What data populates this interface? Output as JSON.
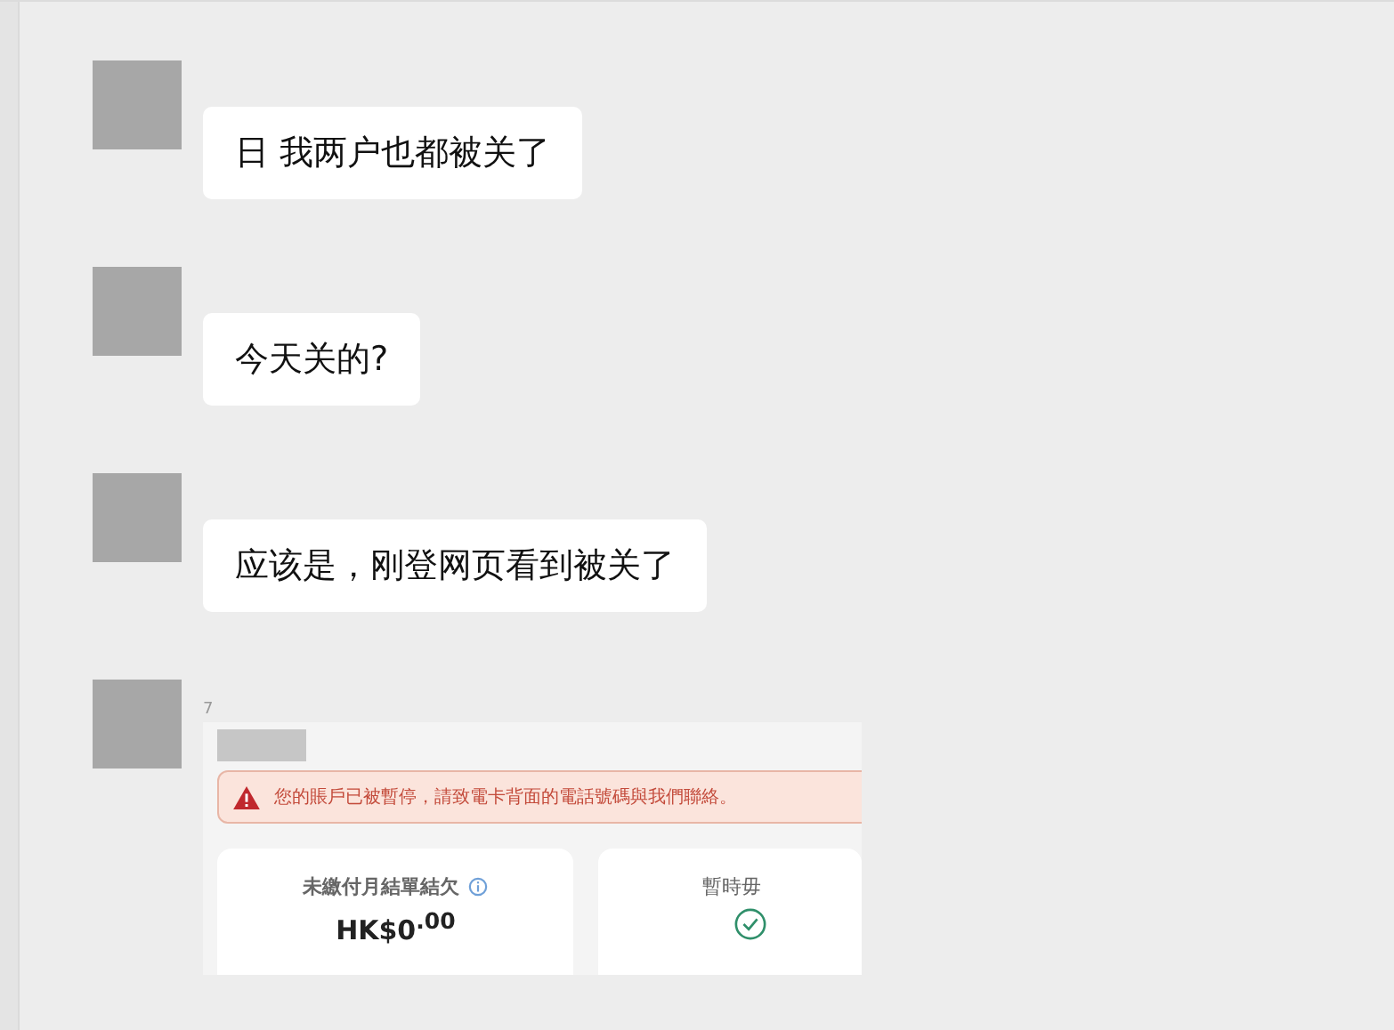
{
  "messages": [
    {
      "kind": "text",
      "text": "日 我两户也都被关了"
    },
    {
      "kind": "text",
      "text": "今天关的?"
    },
    {
      "kind": "text",
      "text": "应该是，刚登网页看到被关了"
    },
    {
      "kind": "image",
      "sender": "7",
      "screenshot": {
        "alert": "您的賬戶已被暫停，請致電卡背面的電話號碼與我們聯絡。",
        "cards": [
          {
            "kind": "amount",
            "title": "未繳付月結單結欠",
            "amount": "HK$0$^{.00}$"
          },
          {
            "kind": "status",
            "title": "暫時毋"
          }
        ]
      }
    }
  ]
}
